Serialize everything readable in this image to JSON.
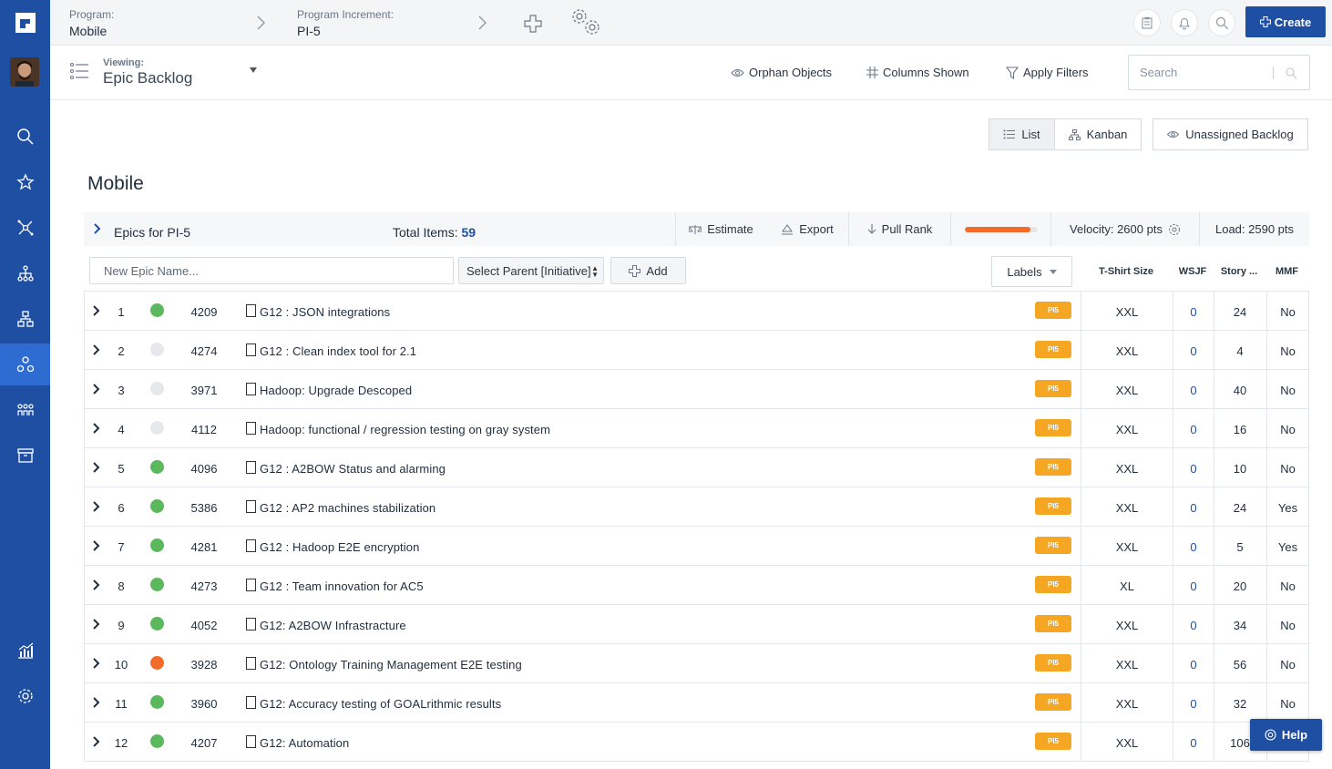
{
  "colors": {
    "sidebar": "#1f4fa3",
    "accent": "#1f4fa3",
    "label": "#f5a623",
    "green": "#5cb85c",
    "grey": "#e6e8eb",
    "orange": "#f26b2a"
  },
  "header": {
    "program_label": "Program:",
    "program_value": "Mobile",
    "pi_label": "Program Increment:",
    "pi_value": "PI-5",
    "create_label": "Create"
  },
  "viewbar": {
    "viewing_label": "Viewing:",
    "viewing_value": "Epic Backlog",
    "orphan_label": "Orphan Objects",
    "columns_label": "Columns Shown",
    "filters_label": "Apply Filters",
    "search_placeholder": "Search"
  },
  "toggles": {
    "list": "List",
    "kanban": "Kanban",
    "unassigned": "Unassigned Backlog"
  },
  "page_title": "Mobile",
  "section": {
    "title": "Epics for  PI-5",
    "total_label": "Total Items:",
    "total_value": "59",
    "estimate": "Estimate",
    "export": "Export",
    "pull_rank": "Pull Rank",
    "progress": 0.9,
    "velocity": "Velocity: 2600 pts",
    "load": "Load: 2590 pts"
  },
  "new_epic": {
    "placeholder": "New Epic Name...",
    "parent_select": "Select Parent [Initiative]",
    "add_label": "Add",
    "labels_label": "Labels"
  },
  "columns": {
    "size": "T-Shirt Size",
    "wsjf": "WSJF",
    "story": "Story ...",
    "mmf": "MMF"
  },
  "rows": [
    {
      "rank": "1",
      "status": "green",
      "id": "4209",
      "name": "G12 : JSON integrations",
      "label": "PI5",
      "size": "XXL",
      "wsjf": "0",
      "story": "24",
      "mmf": "No"
    },
    {
      "rank": "2",
      "status": "grey",
      "id": "4274",
      "name": "G12 : Clean index tool for 2.1",
      "label": "PI5",
      "size": "XXL",
      "wsjf": "0",
      "story": "4",
      "mmf": "No"
    },
    {
      "rank": "3",
      "status": "grey",
      "id": "3971",
      "name": "Hadoop: Upgrade Descoped",
      "label": "PI5",
      "size": "XXL",
      "wsjf": "0",
      "story": "40",
      "mmf": "No"
    },
    {
      "rank": "4",
      "status": "grey",
      "id": "4112",
      "name": "Hadoop: functional / regression testing on gray system",
      "label": "PI5",
      "size": "XXL",
      "wsjf": "0",
      "story": "16",
      "mmf": "No"
    },
    {
      "rank": "5",
      "status": "green",
      "id": "4096",
      "name": "G12 : A2BOW Status and alarming",
      "label": "PI5",
      "size": "XXL",
      "wsjf": "0",
      "story": "10",
      "mmf": "No"
    },
    {
      "rank": "6",
      "status": "green",
      "id": "5386",
      "name": "G12 : AP2 machines stabilization",
      "label": "PI5",
      "size": "XXL",
      "wsjf": "0",
      "story": "24",
      "mmf": "Yes"
    },
    {
      "rank": "7",
      "status": "green",
      "id": "4281",
      "name": "G12 : Hadoop E2E encryption",
      "label": "PI5",
      "size": "XXL",
      "wsjf": "0",
      "story": "5",
      "mmf": "Yes"
    },
    {
      "rank": "8",
      "status": "green",
      "id": "4273",
      "name": "G12 : Team innovation for AC5",
      "label": "PI5",
      "size": "XL",
      "wsjf": "0",
      "story": "20",
      "mmf": "No"
    },
    {
      "rank": "9",
      "status": "green",
      "id": "4052",
      "name": "G12: A2BOW Infrastracture",
      "label": "PI5",
      "size": "XXL",
      "wsjf": "0",
      "story": "34",
      "mmf": "No"
    },
    {
      "rank": "10",
      "status": "orange",
      "id": "3928",
      "name": "G12: Ontology Training Management E2E testing",
      "label": "PI5",
      "size": "XXL",
      "wsjf": "0",
      "story": "56",
      "mmf": "No"
    },
    {
      "rank": "11",
      "status": "green",
      "id": "3960",
      "name": "G12: Accuracy testing of GOALrithmic results",
      "label": "PI5",
      "size": "XXL",
      "wsjf": "0",
      "story": "32",
      "mmf": "No"
    },
    {
      "rank": "12",
      "status": "green",
      "id": "4207",
      "name": "G12: Automation",
      "label": "PI5",
      "size": "XXL",
      "wsjf": "0",
      "story": "106",
      "mmf": ""
    }
  ],
  "help_label": "Help"
}
